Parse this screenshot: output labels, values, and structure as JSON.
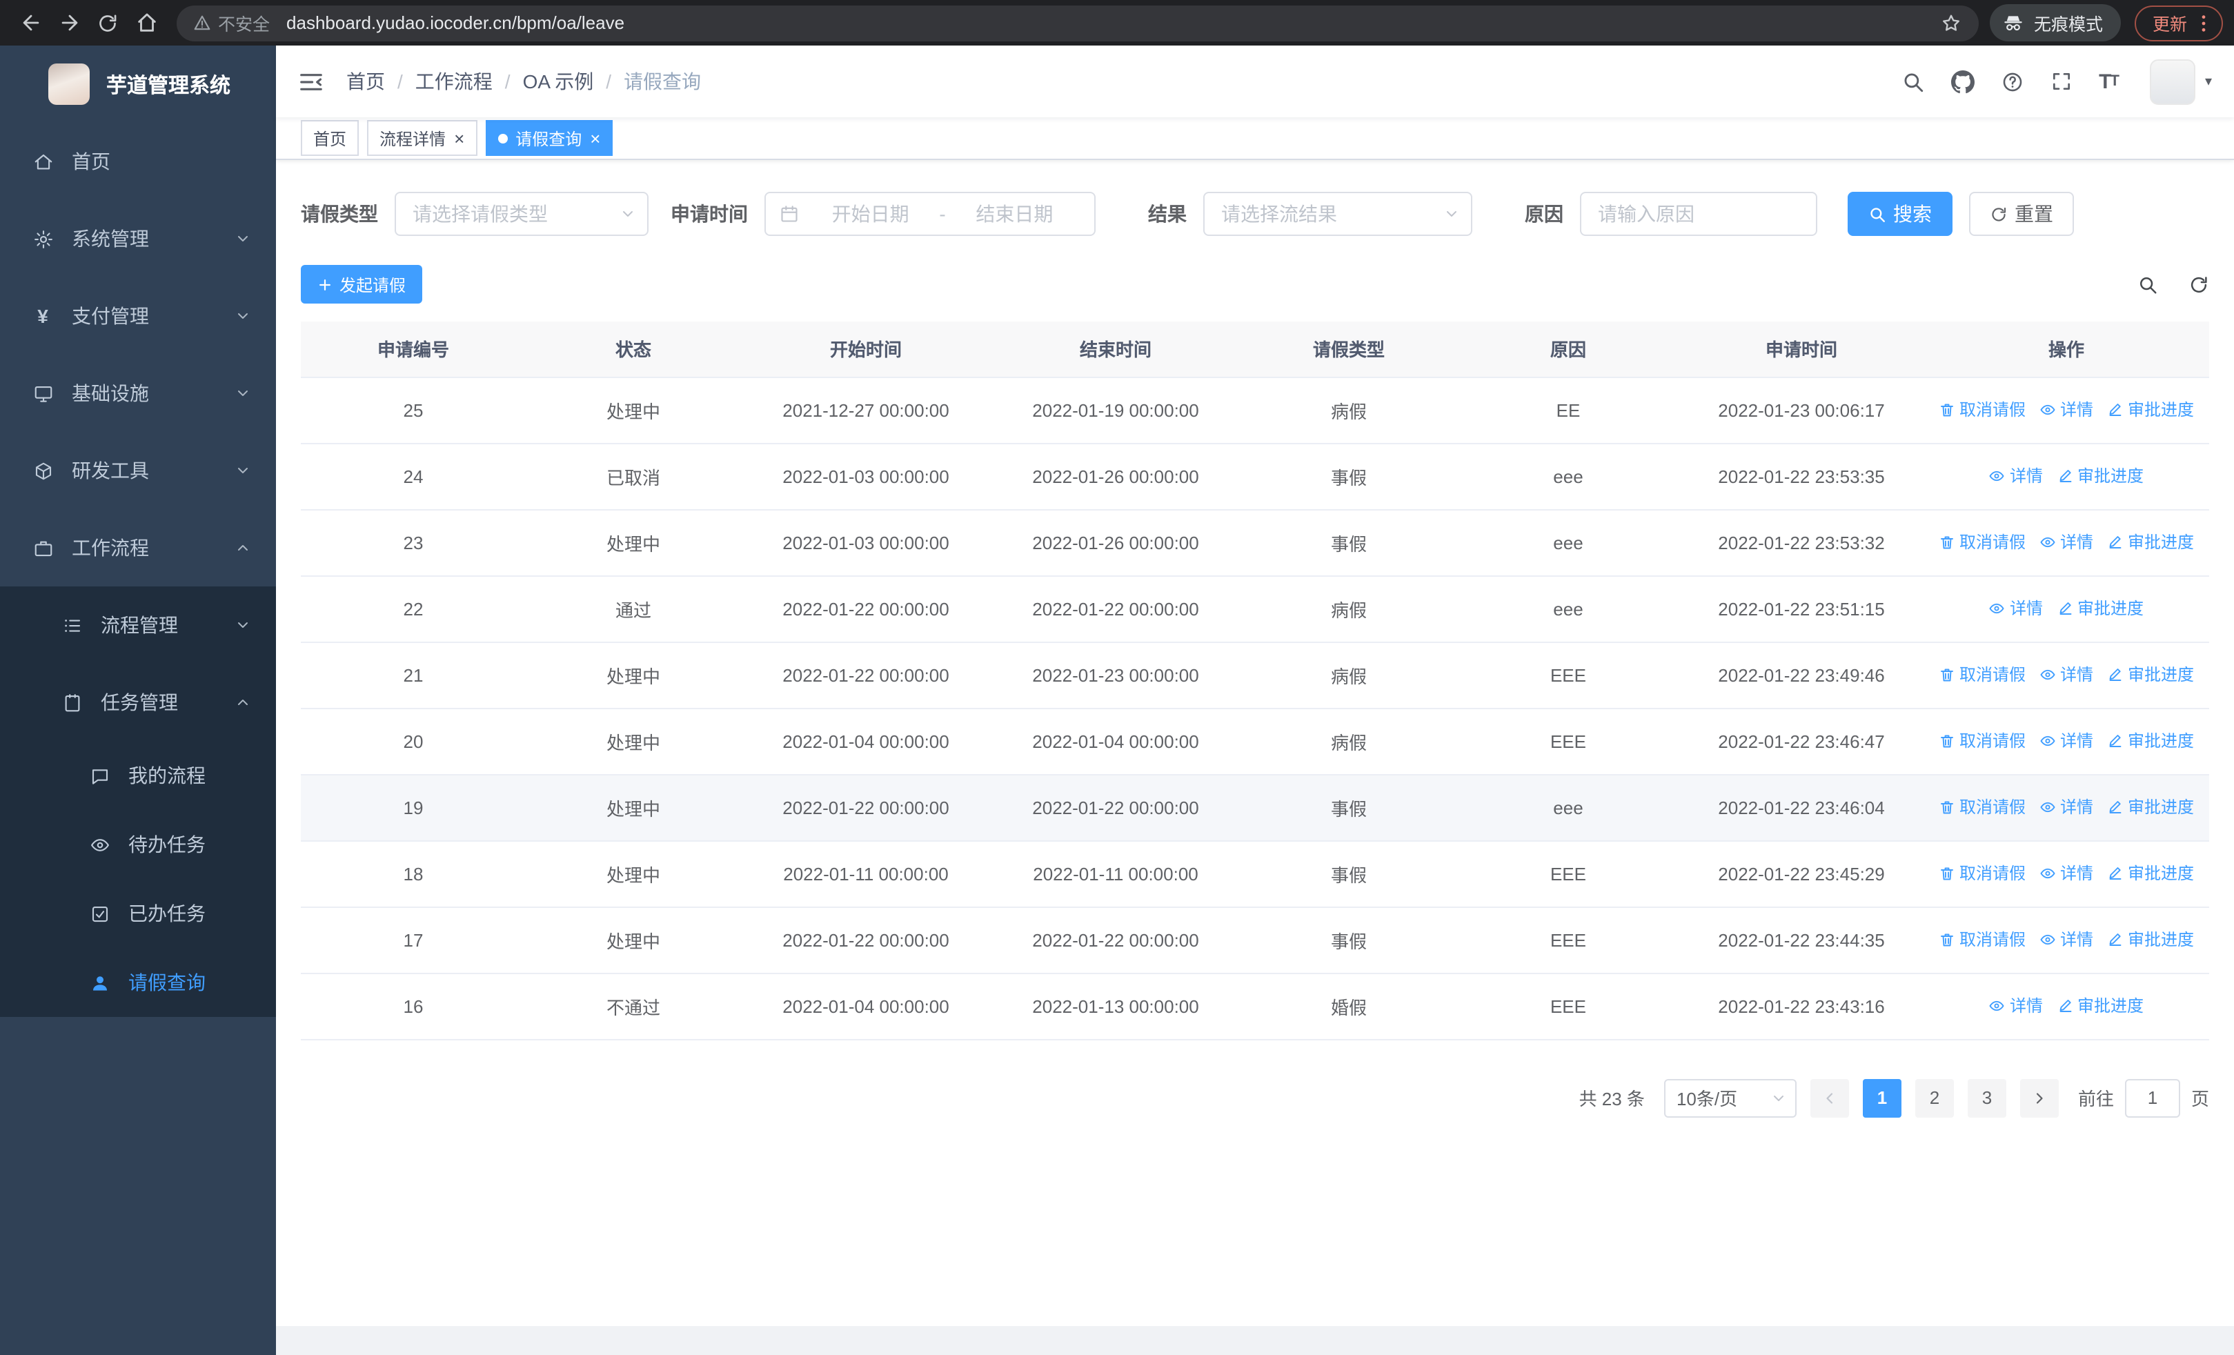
{
  "browser": {
    "security_label": "不安全",
    "url": "dashboard.yudao.iocoder.cn/bpm/oa/leave",
    "incognito_label": "无痕模式",
    "update_label": "更新"
  },
  "icons": {
    "payment_glyph": "¥",
    "caret_down_glyph": "▾",
    "close_glyph": "×"
  },
  "sidebar": {
    "logo_title": "芋道管理系统",
    "items": [
      {
        "label": "首页"
      },
      {
        "label": "系统管理"
      },
      {
        "label": "支付管理"
      },
      {
        "label": "基础设施"
      },
      {
        "label": "研发工具"
      },
      {
        "label": "工作流程"
      },
      {
        "label": "流程管理"
      },
      {
        "label": "任务管理"
      },
      {
        "label": "我的流程"
      },
      {
        "label": "待办任务"
      },
      {
        "label": "已办任务"
      },
      {
        "label": "请假查询"
      }
    ]
  },
  "header": {
    "breadcrumb": [
      "首页",
      "工作流程",
      "OA 示例",
      "请假查询"
    ],
    "separator": "/"
  },
  "tags": [
    {
      "label": "首页"
    },
    {
      "label": "流程详情"
    },
    {
      "label": "请假查询"
    }
  ],
  "filters": {
    "leave_type_label": "请假类型",
    "leave_type_placeholder": "请选择请假类型",
    "apply_time_label": "申请时间",
    "start_date_placeholder": "开始日期",
    "range_separator": "-",
    "end_date_placeholder": "结束日期",
    "result_label": "结果",
    "result_placeholder": "请选择流结果",
    "reason_label": "原因",
    "reason_placeholder": "请输入原因",
    "search_label": "搜索",
    "reset_label": "重置"
  },
  "toolbar": {
    "create_label": "发起请假"
  },
  "table": {
    "columns": [
      "申请编号",
      "状态",
      "开始时间",
      "结束时间",
      "请假类型",
      "原因",
      "申请时间",
      "操作"
    ],
    "action_labels": {
      "cancel": "取消请假",
      "detail": "详情",
      "progress": "审批进度"
    },
    "rows": [
      {
        "id": "25",
        "status": "处理中",
        "start": "2021-12-27 00:00:00",
        "end": "2022-01-19 00:00:00",
        "type": "病假",
        "reason": "EE",
        "applied": "2022-01-23 00:06:17",
        "actions": [
          "cancel",
          "detail",
          "progress"
        ]
      },
      {
        "id": "24",
        "status": "已取消",
        "start": "2022-01-03 00:00:00",
        "end": "2022-01-26 00:00:00",
        "type": "事假",
        "reason": "eee",
        "applied": "2022-01-22 23:53:35",
        "actions": [
          "detail",
          "progress"
        ]
      },
      {
        "id": "23",
        "status": "处理中",
        "start": "2022-01-03 00:00:00",
        "end": "2022-01-26 00:00:00",
        "type": "事假",
        "reason": "eee",
        "applied": "2022-01-22 23:53:32",
        "actions": [
          "cancel",
          "detail",
          "progress"
        ]
      },
      {
        "id": "22",
        "status": "通过",
        "start": "2022-01-22 00:00:00",
        "end": "2022-01-22 00:00:00",
        "type": "病假",
        "reason": "eee",
        "applied": "2022-01-22 23:51:15",
        "actions": [
          "detail",
          "progress"
        ]
      },
      {
        "id": "21",
        "status": "处理中",
        "start": "2022-01-22 00:00:00",
        "end": "2022-01-23 00:00:00",
        "type": "病假",
        "reason": "EEE",
        "applied": "2022-01-22 23:49:46",
        "actions": [
          "cancel",
          "detail",
          "progress"
        ]
      },
      {
        "id": "20",
        "status": "处理中",
        "start": "2022-01-04 00:00:00",
        "end": "2022-01-04 00:00:00",
        "type": "病假",
        "reason": "EEE",
        "applied": "2022-01-22 23:46:47",
        "actions": [
          "cancel",
          "detail",
          "progress"
        ]
      },
      {
        "id": "19",
        "status": "处理中",
        "start": "2022-01-22 00:00:00",
        "end": "2022-01-22 00:00:00",
        "type": "事假",
        "reason": "eee",
        "applied": "2022-01-22 23:46:04",
        "actions": [
          "cancel",
          "detail",
          "progress"
        ],
        "highlighted": true
      },
      {
        "id": "18",
        "status": "处理中",
        "start": "2022-01-11 00:00:00",
        "end": "2022-01-11 00:00:00",
        "type": "事假",
        "reason": "EEE",
        "applied": "2022-01-22 23:45:29",
        "actions": [
          "cancel",
          "detail",
          "progress"
        ]
      },
      {
        "id": "17",
        "status": "处理中",
        "start": "2022-01-22 00:00:00",
        "end": "2022-01-22 00:00:00",
        "type": "事假",
        "reason": "EEE",
        "applied": "2022-01-22 23:44:35",
        "actions": [
          "cancel",
          "detail",
          "progress"
        ]
      },
      {
        "id": "16",
        "status": "不通过",
        "start": "2022-01-04 00:00:00",
        "end": "2022-01-13 00:00:00",
        "type": "婚假",
        "reason": "EEE",
        "applied": "2022-01-22 23:43:16",
        "actions": [
          "detail",
          "progress"
        ]
      }
    ]
  },
  "pagination": {
    "total_label": "共 23 条",
    "page_size": "10条/页",
    "pages": [
      "1",
      "2",
      "3"
    ],
    "current_page": "1",
    "goto_label": "前往",
    "goto_value": "1",
    "page_suffix": "页"
  }
}
